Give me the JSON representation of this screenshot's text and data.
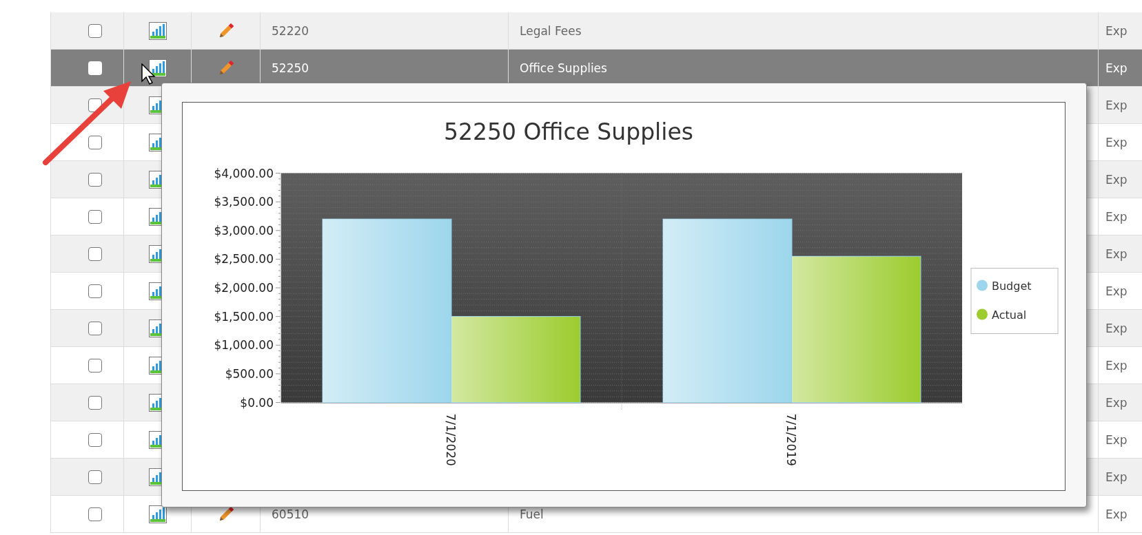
{
  "rows": [
    {
      "selected": false,
      "checked": false,
      "code": "52220",
      "name": "Legal Fees",
      "type": "Exp"
    },
    {
      "selected": true,
      "checked": false,
      "code": "52250",
      "name": "Office Supplies",
      "type": "Exp"
    },
    {
      "selected": false,
      "checked": false,
      "type": "Exp"
    },
    {
      "selected": false,
      "checked": false,
      "type": "Exp"
    },
    {
      "selected": false,
      "checked": false,
      "type": "Exp"
    },
    {
      "selected": false,
      "checked": false,
      "type": "Exp"
    },
    {
      "selected": false,
      "checked": false,
      "type": "Exp"
    },
    {
      "selected": false,
      "checked": false,
      "type": "Exp"
    },
    {
      "selected": false,
      "checked": false,
      "type": "Exp"
    },
    {
      "selected": false,
      "checked": false,
      "type": "Exp"
    },
    {
      "selected": false,
      "checked": false,
      "type": "Exp"
    },
    {
      "selected": false,
      "checked": false,
      "type": "Exp"
    },
    {
      "selected": false,
      "checked": false,
      "type": "Exp"
    },
    {
      "selected": false,
      "checked": false,
      "code": "60510",
      "name": "Fuel",
      "type": "Exp"
    }
  ],
  "popup": {
    "chart_data": {
      "type": "bar",
      "title": "52250 Office Supplies",
      "categories": [
        "7/1/2020",
        "7/1/2019"
      ],
      "series": [
        {
          "name": "Budget",
          "color": "#9dd6ec",
          "values": [
            3200,
            3200
          ]
        },
        {
          "name": "Actual",
          "color": "#9ccc2e",
          "values": [
            1500,
            2550
          ]
        }
      ],
      "ylim": [
        0,
        4000
      ],
      "grid": true,
      "legend": true,
      "yticks": [
        {
          "value": 0,
          "label": "$0.00"
        },
        {
          "value": 500,
          "label": "$500.00"
        },
        {
          "value": 1000,
          "label": "$1,000.00"
        },
        {
          "value": 1500,
          "label": "$1,500.00"
        },
        {
          "value": 2000,
          "label": "$2,000.00"
        },
        {
          "value": 2500,
          "label": "$2,500.00"
        },
        {
          "value": 3000,
          "label": "$3,000.00"
        },
        {
          "value": 3500,
          "label": "$3,500.00"
        },
        {
          "value": 4000,
          "label": "$4,000.00"
        }
      ]
    }
  }
}
